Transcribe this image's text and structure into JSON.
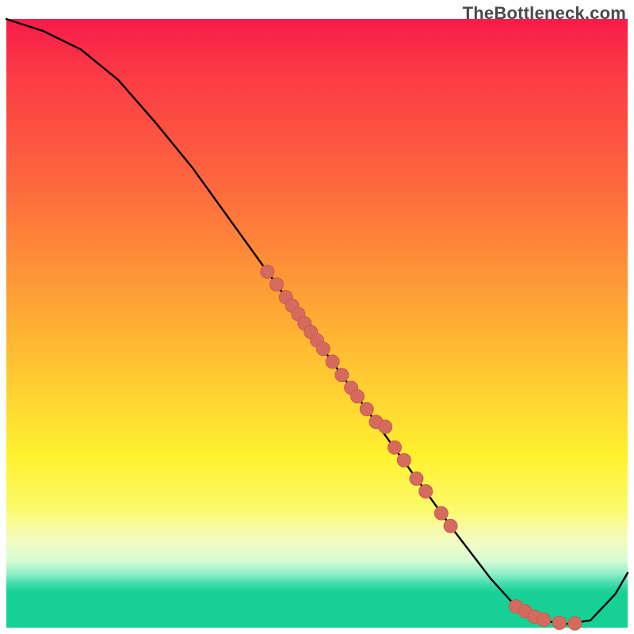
{
  "watermark": "TheBottleneck.com",
  "colors": {
    "line": "#000000",
    "point_fill": "#d76a5f",
    "point_stroke": "#c65c50"
  },
  "chart_data": {
    "type": "line",
    "title": "",
    "xlabel": "",
    "ylabel": "",
    "xlim": [
      0,
      100
    ],
    "ylim": [
      0,
      100
    ],
    "grid": false,
    "series": [
      {
        "name": "curve",
        "x": [
          0,
          6,
          12,
          18,
          24,
          30,
          36,
          42,
          48,
          54,
          60,
          66,
          72,
          78,
          82,
          86,
          90,
          94,
          98,
          100
        ],
        "y": [
          100,
          98,
          95,
          90,
          83,
          75.5,
          67,
          58.5,
          50,
          41.5,
          33,
          24.5,
          16,
          8,
          3.5,
          1.2,
          0.6,
          1.2,
          5.5,
          9
        ]
      }
    ],
    "points_on_curve": [
      {
        "name": "cluster_upper",
        "x": [
          42,
          43.5,
          45,
          46,
          47,
          48,
          49,
          50,
          51,
          52.5,
          54,
          55.5,
          56.5,
          58,
          59.5,
          61,
          62.5,
          64,
          66,
          67.5
        ],
        "y": [
          58.5,
          56.4,
          54.3,
          52.9,
          51.5,
          50,
          48.6,
          47.2,
          45.8,
          43.7,
          41.5,
          39.4,
          38,
          35.9,
          33.8,
          33,
          29.6,
          27.5,
          24.5,
          22.4
        ]
      },
      {
        "name": "cluster_lower_line",
        "x": [
          70,
          71.5
        ],
        "y": [
          18.8,
          16.7
        ]
      },
      {
        "name": "cluster_bottom",
        "x": [
          82,
          83.5,
          85,
          86.5,
          89,
          91.5
        ],
        "y": [
          3.5,
          2.7,
          1.8,
          1.3,
          0.8,
          0.7
        ]
      }
    ]
  }
}
